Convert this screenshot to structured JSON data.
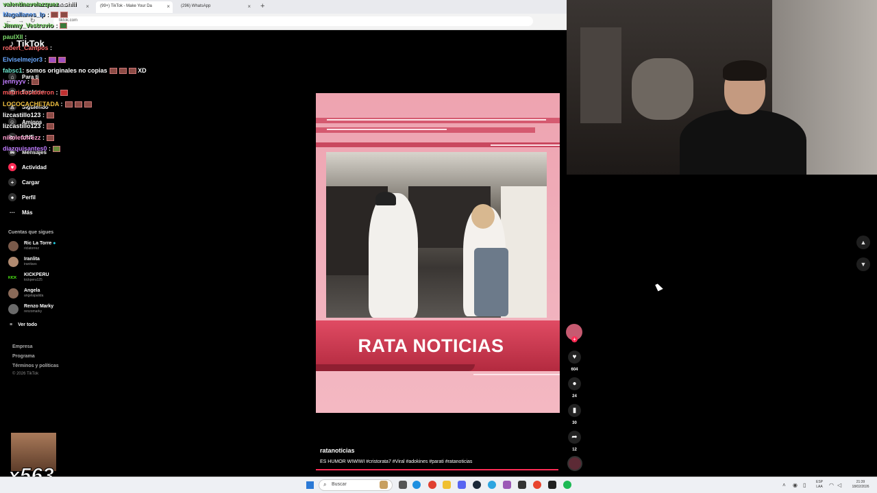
{
  "browser": {
    "tabs": [
      {
        "label": "(99+) TikTok - Make Your Da",
        "active": true
      },
      {
        "label": "(296) WhatsApp",
        "active": false
      }
    ],
    "background_tab_label": "Stream · Kick Dashboard",
    "address": "tiktok.com"
  },
  "sidebar": {
    "logo": "TikTok",
    "nav": [
      {
        "label": "Para ti",
        "icon": "home-icon"
      },
      {
        "label": "Explorar",
        "icon": "compass-icon"
      },
      {
        "label": "Siguiendo",
        "icon": "following-icon"
      },
      {
        "label": "Amigos",
        "icon": "friends-icon"
      },
      {
        "label": "LIVE",
        "icon": "live-icon"
      },
      {
        "label": "Mensajes",
        "icon": "message-icon"
      },
      {
        "label": "Actividad",
        "icon": "activity-icon"
      },
      {
        "label": "Cargar",
        "icon": "upload-icon"
      },
      {
        "label": "Perfil",
        "icon": "profile-icon"
      },
      {
        "label": "Más",
        "icon": "more-icon"
      }
    ],
    "following_title": "Cuentas que sigues",
    "accounts": [
      {
        "name": "Ric La Torre",
        "handle": "riclatorrez",
        "verified": true
      },
      {
        "name": "Iranlita",
        "handle": "iranitavs",
        "verified": false
      },
      {
        "name": "KICKPERU",
        "handle": "kickperu125",
        "verified": false
      },
      {
        "name": "Angela",
        "handle": "angelapalida",
        "verified": false
      },
      {
        "name": "Renzo Marky",
        "handle": "renzomarky",
        "verified": false
      }
    ],
    "see_all": "Ver todo",
    "footer": [
      "Empresa",
      "Programa",
      "Términos y políticas"
    ],
    "copyright": "© 2026 TikTok"
  },
  "chat": [
    {
      "user": "valentinavelazquez",
      "msg": ": shiii",
      "color": "#7cd96a"
    },
    {
      "user": "Magallanes_lp",
      "msg": ":",
      "color": "#6aa9ff"
    },
    {
      "user": "Jimmy_Vestruvio",
      "msg": ":",
      "color": "#7cd96a"
    },
    {
      "user": "paulXII",
      "msg": ":",
      "color": "#7cd96a"
    },
    {
      "user": "robert_Campos",
      "msg": ":",
      "color": "#ff6b6b"
    },
    {
      "user": "Elviselmejor3",
      "msg": ":",
      "color": "#6aa9ff"
    },
    {
      "user": "fabsc1",
      "msg": ": somos originales no copias",
      "color": "#6ee7d0"
    },
    {
      "user": "jennyyv",
      "msg": ":",
      "color": "#c07cff"
    },
    {
      "user": "mauriciocalderon",
      "msg": ":",
      "color": "#ff5a5a"
    },
    {
      "user": "LOCOCACHETADA",
      "msg": ":",
      "color": "#f0c040"
    },
    {
      "user": "lizcastillo123",
      "msg": ":",
      "color": "#ffffff"
    },
    {
      "user": "lizcastillo123",
      "msg": ":",
      "color": "#ffffff"
    },
    {
      "user": "nikoletorrezz",
      "msg": ":",
      "color": "#ff9ecf"
    },
    {
      "user": "diazquisantes0",
      "msg": ":",
      "color": "#c07cff"
    }
  ],
  "chat_suffix_xd": "XD",
  "video": {
    "banner": "RATA NOTICIAS",
    "author": "ratanoticias",
    "caption": "ES HUMOR  WIWIWI #cristorata7 #Viral #adokines #parati #ratanoticias"
  },
  "actions": {
    "likes": "604",
    "comments": "24",
    "saves": "30",
    "shares": "12"
  },
  "overlay": {
    "combo": "x563"
  },
  "taskbar": {
    "search_placeholder": "Buscar",
    "lang_top": "ESP",
    "lang_bottom": "LAA",
    "time": "21:39",
    "date": "18/02/2026"
  },
  "colors": {
    "accent": "#fe2c55",
    "banner": "#b32a3f"
  }
}
